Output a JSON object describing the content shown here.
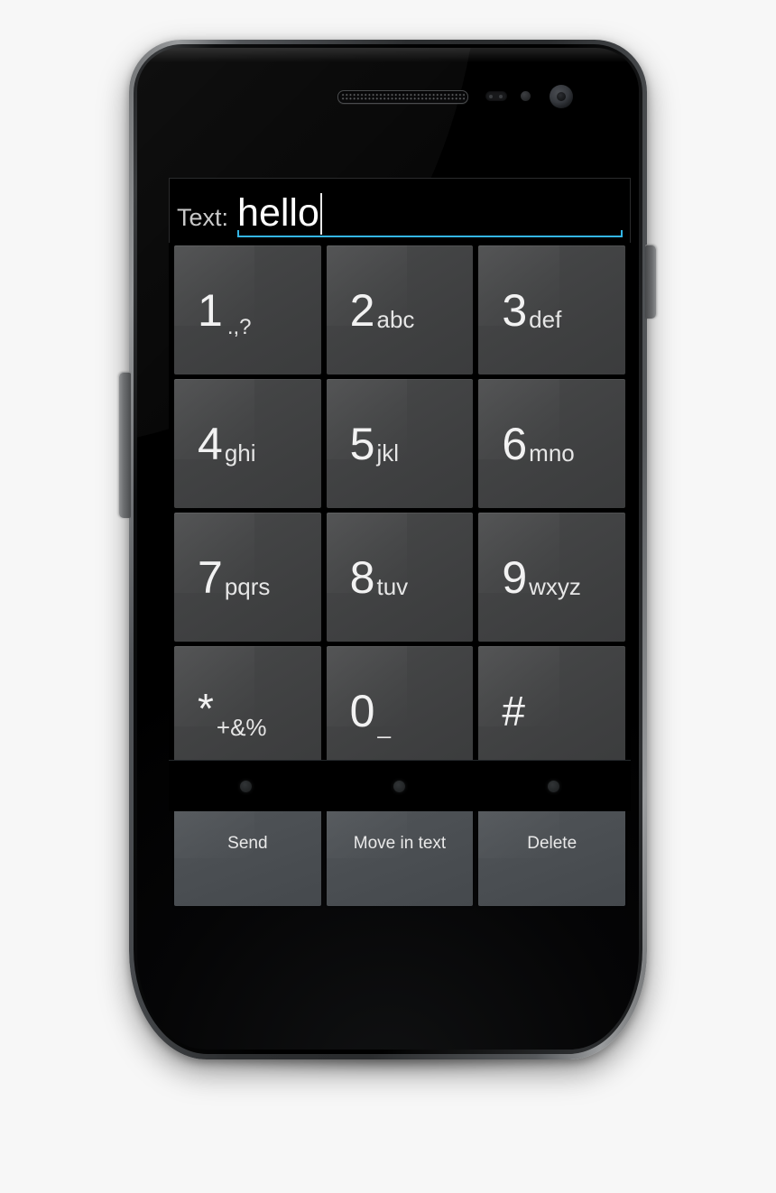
{
  "device": {
    "name": "android-phone",
    "hardware": {
      "earpiece_speaker": "earpiece-speaker",
      "proximity_sensor": "proximity-sensor",
      "light_sensor": "light-sensor",
      "front_camera": "front-camera",
      "volume_rocker": "volume-rocker",
      "power_button": "power-button"
    }
  },
  "colors": {
    "accent_underline": "#33b5e5",
    "key_face": "#43 44 45",
    "action_key_face": "#4d5155",
    "screen_background": "#000000",
    "text_primary": "#ffffff",
    "label_text": "#c9c9c9"
  },
  "app": {
    "text_field": {
      "label": "Text:",
      "value": "hello",
      "placeholder": "",
      "caret_visible": true
    },
    "keypad": {
      "rows": [
        [
          {
            "digit": "1",
            "letters": ".,?",
            "name": "key-1"
          },
          {
            "digit": "2",
            "letters": "abc",
            "name": "key-2"
          },
          {
            "digit": "3",
            "letters": "def",
            "name": "key-3"
          }
        ],
        [
          {
            "digit": "4",
            "letters": "ghi",
            "name": "key-4"
          },
          {
            "digit": "5",
            "letters": "jkl",
            "name": "key-5"
          },
          {
            "digit": "6",
            "letters": "mno",
            "name": "key-6"
          }
        ],
        [
          {
            "digit": "7",
            "letters": "pqrs",
            "name": "key-7"
          },
          {
            "digit": "8",
            "letters": "tuv",
            "name": "key-8"
          },
          {
            "digit": "9",
            "letters": "wxyz",
            "name": "key-9"
          }
        ],
        [
          {
            "digit": "*",
            "letters": "+&%",
            "name": "key-star"
          },
          {
            "digit": "0",
            "letters": "_",
            "name": "key-0"
          },
          {
            "digit": "#",
            "letters": "",
            "name": "key-hash"
          }
        ]
      ],
      "actions": [
        {
          "label": "Send",
          "name": "send-button"
        },
        {
          "label": "Move in text",
          "name": "move-in-text-button"
        },
        {
          "label": "Delete",
          "name": "delete-button"
        }
      ]
    },
    "nav_bar": {
      "buttons": [
        "back",
        "home",
        "recents"
      ]
    }
  }
}
